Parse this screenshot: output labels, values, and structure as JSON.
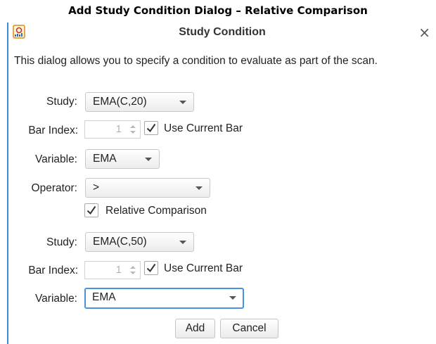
{
  "caption": "Add Study Condition Dialog – Relative Comparison",
  "dialog": {
    "title": "Study Condition",
    "close_symbol": "×",
    "description": "This dialog allows you to specify a condition to evaluate as part of the scan.",
    "icon": "study-app-icon"
  },
  "first": {
    "study_label": "Study:",
    "study_value": "EMA(C,20)",
    "bar_index_label": "Bar Index:",
    "bar_index_value": "1",
    "use_current_bar_label": "Use Current Bar",
    "use_current_bar_checked": true,
    "variable_label": "Variable:",
    "variable_value": "EMA"
  },
  "operator": {
    "label": "Operator:",
    "value": ">",
    "relative_comparison_label": "Relative Comparison",
    "relative_comparison_checked": true
  },
  "second": {
    "study_label": "Study:",
    "study_value": "EMA(C,50)",
    "bar_index_label": "Bar Index:",
    "bar_index_value": "1",
    "use_current_bar_label": "Use Current Bar",
    "use_current_bar_checked": true,
    "variable_label": "Variable:",
    "variable_value": "EMA"
  },
  "buttons": {
    "add": "Add",
    "cancel": "Cancel"
  },
  "colors": {
    "accent": "#3f87d6",
    "focus": "#4a90e2"
  }
}
